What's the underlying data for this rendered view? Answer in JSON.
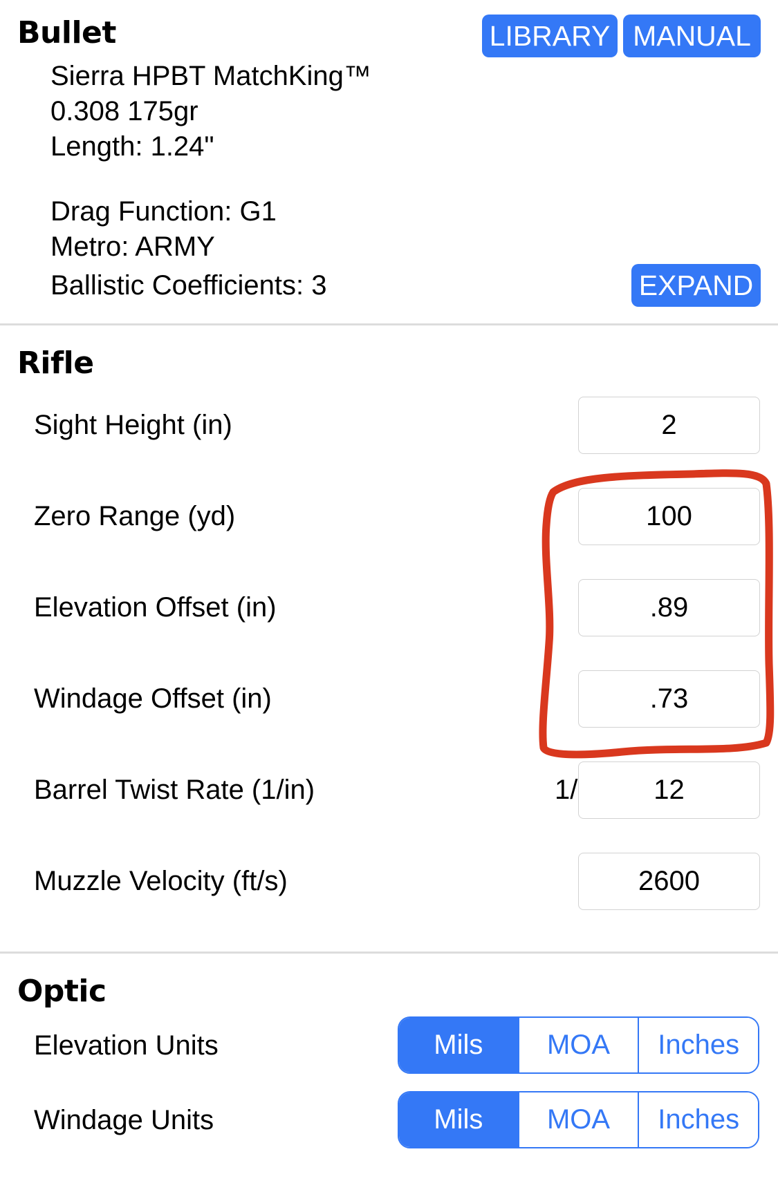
{
  "bullet": {
    "title": "Bullet",
    "library_label": "LIBRARY",
    "manual_label": "MANUAL",
    "name": "Sierra HPBT MatchKing™",
    "caliber_weight": "0.308 175gr",
    "length": "Length: 1.24\"",
    "drag_function": "Drag Function: G1",
    "metro": "Metro: ARMY",
    "ballistic_coefficients": "Ballistic Coefficients: 3",
    "expand_label": "EXPAND"
  },
  "rifle": {
    "title": "Rifle",
    "sight_height": {
      "label": "Sight Height (in)",
      "value": "2"
    },
    "zero_range": {
      "label": "Zero Range (yd)",
      "value": "100"
    },
    "elevation_offset": {
      "label": "Elevation Offset (in)",
      "value": ".89"
    },
    "windage_offset": {
      "label": "Windage Offset (in)",
      "value": ".73"
    },
    "barrel_twist": {
      "label": "Barrel Twist Rate (1/in)",
      "prefix": "1/",
      "value": "12"
    },
    "muzzle_velocity": {
      "label": "Muzzle Velocity (ft/s)",
      "value": "2600"
    }
  },
  "optic": {
    "title": "Optic",
    "elevation_units": {
      "label": "Elevation Units",
      "options": [
        "Mils",
        "MOA",
        "Inches"
      ],
      "selected": "Mils"
    },
    "windage_units": {
      "label": "Windage Units",
      "options": [
        "Mils",
        "MOA",
        "Inches"
      ],
      "selected": "Mils"
    }
  },
  "colors": {
    "accent": "#3478f6",
    "annotation": "#d9381e",
    "divider": "#dcdcdc"
  }
}
